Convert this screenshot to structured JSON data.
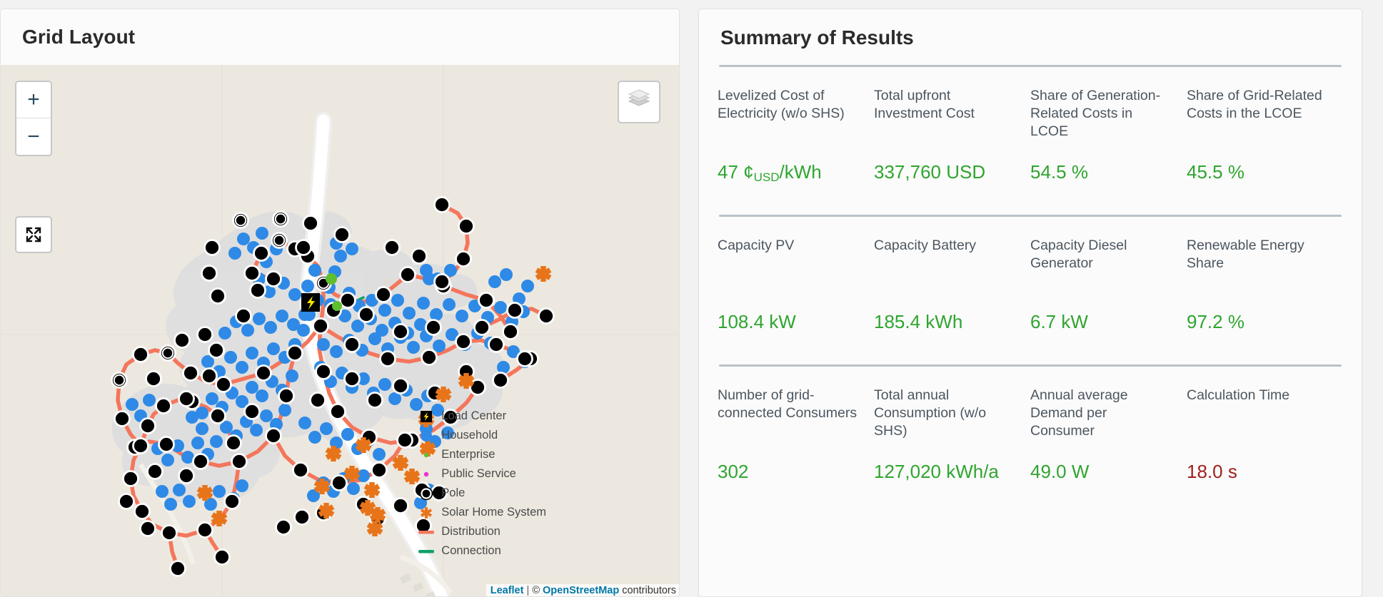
{
  "map_panel": {
    "title": "Grid Layout",
    "controls": {
      "zoom_in": "+",
      "zoom_out": "−",
      "fullscreen_name": "fullscreen-button",
      "layers_name": "layers-button"
    },
    "legend": [
      {
        "label": "Load Center",
        "key": "load-center-icon",
        "color": "#f5e400"
      },
      {
        "label": "Household",
        "key": "household-dot-icon",
        "color": "#2e8ae6"
      },
      {
        "label": "Enterprise",
        "key": "enterprise-dot-icon",
        "color": "#5fbf2e"
      },
      {
        "label": "Public Service",
        "key": "public-service-dot-icon",
        "color": "#ef2fd6"
      },
      {
        "label": "Pole",
        "key": "pole-icon",
        "color": "#000000"
      },
      {
        "label": "Solar Home System",
        "key": "solar-home-system-icon",
        "color": "#e8741a"
      },
      {
        "label": "Distribution",
        "key": "distribution-line-icon",
        "color": "#f4765c"
      },
      {
        "label": "Connection",
        "key": "connection-line-icon",
        "color": "#12a06a"
      }
    ],
    "attribution": {
      "leaflet": "Leaflet",
      "separator": "|",
      "copyright": "©",
      "osm": "OpenStreetMap",
      "contributors": "contributors"
    }
  },
  "summary_panel": {
    "title": "Summary of Results",
    "rows": [
      {
        "cells": [
          {
            "label": "Levelized Cost of Electricity (w/o SHS)",
            "value": "47 ¢",
            "value_sub": "USD",
            "value_tail": "/kWh",
            "tone": "good"
          },
          {
            "label": "Total upfront Investment Cost",
            "value": "337,760 USD",
            "tone": "good"
          },
          {
            "label": "Share of Generation-Related Costs in LCOE",
            "value": "54.5 %",
            "tone": "good"
          },
          {
            "label": "Share of Grid-Related Costs in the LCOE",
            "value": "45.5 %",
            "tone": "good"
          }
        ]
      },
      {
        "cells": [
          {
            "label": "Capacity PV",
            "value": "108.4 kW",
            "tone": "good"
          },
          {
            "label": "Capacity Battery",
            "value": "185.4 kWh",
            "tone": "good"
          },
          {
            "label": "Capacity Diesel Generator",
            "value": "6.7 kW",
            "tone": "good"
          },
          {
            "label": "Renewable Energy Share",
            "value": "97.2 %",
            "tone": "good"
          }
        ]
      },
      {
        "cells": [
          {
            "label": "Number of grid-connected Consumers",
            "value": "302",
            "tone": "good"
          },
          {
            "label": "Total annual Consumption (w/o SHS)",
            "value": "127,020 kWh/a",
            "tone": "good"
          },
          {
            "label": "Annual average Demand per Consumer",
            "value": "49.0 W",
            "tone": "good"
          },
          {
            "label": "Calculation Time",
            "value": "18.0 s",
            "tone": "warn"
          }
        ]
      }
    ]
  },
  "colors": {
    "value_good": "#2fa52f",
    "value_warn": "#a02020",
    "label": "#4c565f",
    "divider": "#b9c2c9",
    "map_background": "#ece8df",
    "map_landuse": "#dcdcdc",
    "road": "#ffffff",
    "household": "#2e8ae6",
    "pole": "#000000",
    "distribution": "#f4765c",
    "shs": "#e8741a",
    "enterprise": "#5fbf2e"
  }
}
